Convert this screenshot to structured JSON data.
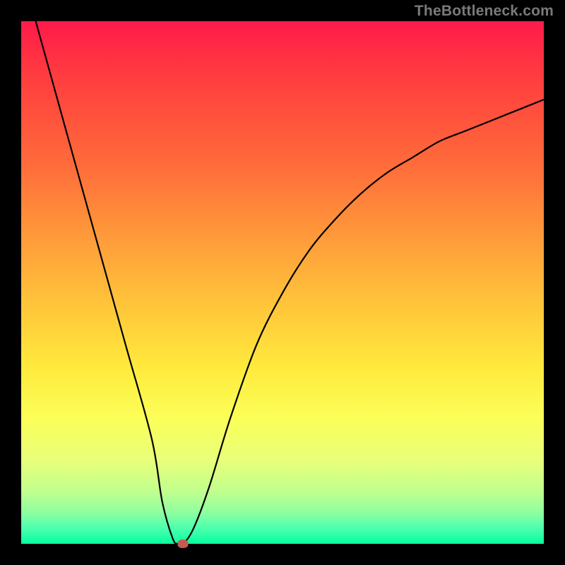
{
  "watermark": "TheBottleneck.com",
  "colors": {
    "frame": "#000000",
    "curve": "#000000",
    "marker": "#c45a52"
  },
  "chart_data": {
    "type": "line",
    "title": "",
    "xlabel": "",
    "ylabel": "",
    "xlim": [
      0,
      100
    ],
    "ylim": [
      0,
      100
    ],
    "grid": false,
    "legend": false,
    "series": [
      {
        "name": "bottleneck-curve",
        "x": [
          0,
          5,
          10,
          15,
          20,
          25,
          27,
          29,
          30,
          31,
          33,
          36,
          40,
          45,
          50,
          55,
          60,
          65,
          70,
          75,
          80,
          85,
          90,
          95,
          100
        ],
        "y": [
          110,
          92,
          74,
          56,
          38,
          20,
          8,
          1,
          0,
          0,
          3,
          11,
          24,
          38,
          48,
          56,
          62,
          67,
          71,
          74,
          77,
          79,
          81,
          83,
          85
        ]
      }
    ],
    "marker": {
      "x": 31,
      "y": 0
    },
    "gradient_stops": [
      {
        "pos": 0,
        "color": "#ff1a4a"
      },
      {
        "pos": 10,
        "color": "#ff3b3f"
      },
      {
        "pos": 28,
        "color": "#ff6d3a"
      },
      {
        "pos": 40,
        "color": "#ff963a"
      },
      {
        "pos": 54,
        "color": "#ffc43a"
      },
      {
        "pos": 66,
        "color": "#ffe93c"
      },
      {
        "pos": 76,
        "color": "#fbff58"
      },
      {
        "pos": 84,
        "color": "#e8ff7a"
      },
      {
        "pos": 90,
        "color": "#c0ff8e"
      },
      {
        "pos": 94,
        "color": "#8fffa0"
      },
      {
        "pos": 97,
        "color": "#4cffae"
      },
      {
        "pos": 100,
        "color": "#06ff9e"
      }
    ]
  }
}
